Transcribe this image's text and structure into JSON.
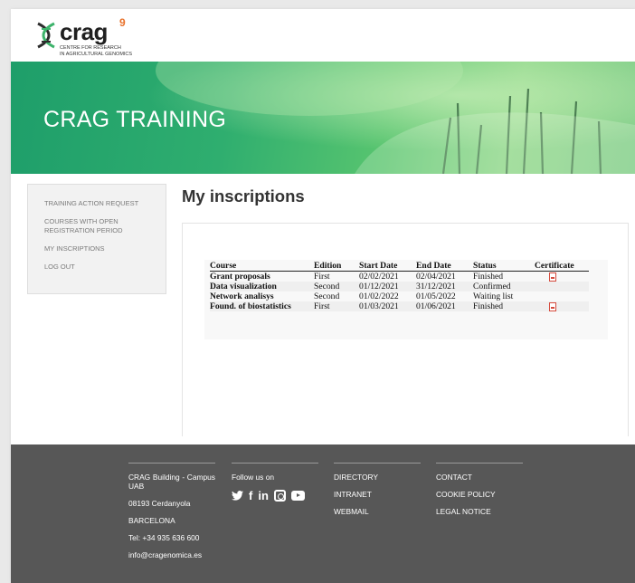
{
  "brand": {
    "name": "crag",
    "superscript": "9",
    "tagline_line1": "CENTRE FOR RESEARCH",
    "tagline_line2": "IN AGRICULTURAL GENOMICS"
  },
  "hero": {
    "title": "CRAG TRAINING"
  },
  "sidebar": {
    "items": [
      {
        "label": "TRAINING ACTION REQUEST"
      },
      {
        "label": "COURSES WITH OPEN REGISTRATION PERIOD"
      },
      {
        "label": "MY INSCRIPTIONS"
      },
      {
        "label": "LOG OUT"
      }
    ]
  },
  "main": {
    "title": "My inscriptions",
    "table": {
      "headers": [
        "Course",
        "Edition",
        "Start Date",
        "End Date",
        "Status",
        "Certificate"
      ],
      "rows": [
        {
          "course": "Grant proposals",
          "edition": "First",
          "start": "02/02/2021",
          "end": "02/04/2021",
          "status": "Finished",
          "certificate_icon": "pdf-icon"
        },
        {
          "course": "Data visualization",
          "edition": "Second",
          "start": "01/12/2021",
          "end": "31/12/2021",
          "status": "Confirmed",
          "certificate_icon": ""
        },
        {
          "course": "Network analisys",
          "edition": "Second",
          "start": "01/02/2022",
          "end": "01/05/2022",
          "status": "Waiting list",
          "certificate_icon": ""
        },
        {
          "course": "Found. of biostatistics",
          "edition": "First",
          "start": "01/03/2021",
          "end": "01/06/2021",
          "status": "Finished",
          "certificate_icon": "pdf-icon"
        }
      ]
    }
  },
  "footer": {
    "address": {
      "line1": "CRAG Building - Campus UAB",
      "line2": "08193 Cerdanyola",
      "line3": "BARCELONA",
      "phone": "Tel: +34 935 636 600",
      "email": "info@cragenomica.es"
    },
    "social": {
      "label": "Follow us on",
      "icons": [
        "twitter-icon",
        "facebook-icon",
        "linkedin-icon",
        "instagram-icon",
        "youtube-icon"
      ]
    },
    "links1": [
      "DIRECTORY",
      "INTRANET",
      "WEBMAIL"
    ],
    "links2": [
      "CONTACT",
      "COOKIE POLICY",
      "LEGAL NOTICE"
    ]
  },
  "colors": {
    "hero_green": "#2fae6f",
    "footer_bg": "#575757",
    "accent_orange": "#e8712a",
    "pdf_red": "#d54b3d"
  }
}
